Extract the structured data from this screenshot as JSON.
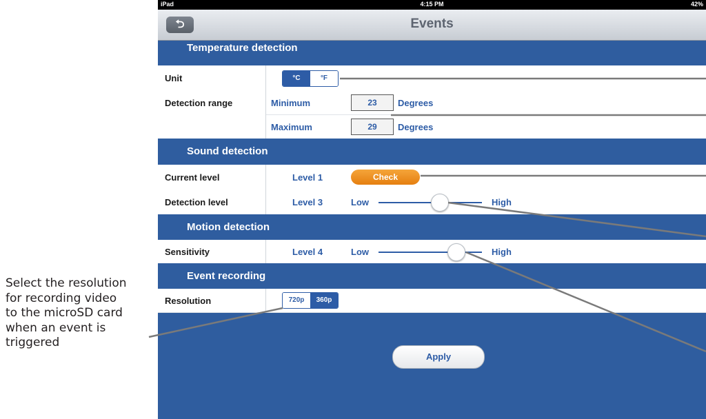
{
  "annotation": {
    "lines": [
      "Select the resolution",
      "for recording video",
      "to the microSD card",
      "when an event is",
      "triggered"
    ]
  },
  "status_bar": {
    "device": "iPad",
    "time": "4:15 PM",
    "battery": "42%"
  },
  "nav": {
    "title": "Events",
    "back_icon": "back-arrow-icon"
  },
  "sections": {
    "temperature": "Temperature detection",
    "sound": "Sound detection",
    "motion": "Motion detection",
    "recording": "Event recording"
  },
  "temperature": {
    "unit_label": "Unit",
    "unit_options": [
      "°C",
      "°F"
    ],
    "unit_selected": "°C",
    "range_label": "Detection range",
    "min_label": "Minimum",
    "min_value": "23",
    "max_label": "Maximum",
    "max_value": "29",
    "units_text": "Degrees"
  },
  "sound": {
    "current_label": "Current level",
    "current_value": "Level 1",
    "check_label": "Check",
    "detection_label": "Detection level",
    "detection_value": "Level 3",
    "low": "Low",
    "high": "High"
  },
  "motion": {
    "sensitivity_label": "Sensitivity",
    "sensitivity_value": "Level 4",
    "low": "Low",
    "high": "High"
  },
  "recording": {
    "resolution_label": "Resolution",
    "options": [
      "720p",
      "360p"
    ],
    "selected": "720p"
  },
  "apply_label": "Apply",
  "colors": {
    "accent": "#2d5ca6",
    "section_bg": "#2f5d9f",
    "check_button": "#f0961f"
  }
}
